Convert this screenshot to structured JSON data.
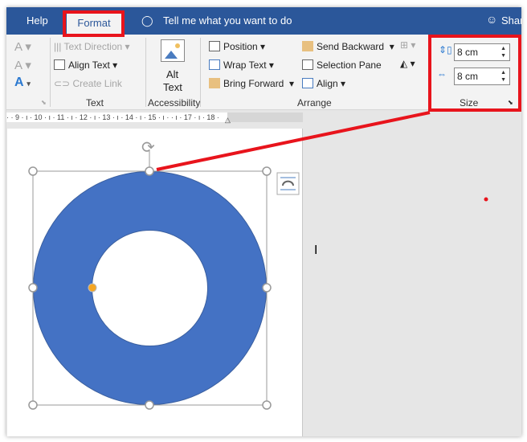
{
  "tabs": {
    "help": "Help",
    "format": "Format",
    "tell_me": "Tell me what you want to do",
    "share": "Share"
  },
  "ribbon": {
    "text_group": {
      "text_direction": "Text Direction",
      "align_text": "Align Text",
      "create_link": "Create Link",
      "label": "Text"
    },
    "accessibility_group": {
      "alt_text_line1": "Alt",
      "alt_text_line2": "Text",
      "label": "Accessibility"
    },
    "arrange_group": {
      "position": "Position",
      "wrap_text": "Wrap Text",
      "bring_forward": "Bring Forward",
      "send_backward": "Send Backward",
      "selection_pane": "Selection Pane",
      "align": "Align",
      "label": "Arrange"
    },
    "size_group": {
      "height": "8 cm",
      "width": "8 cm",
      "label": "Size"
    }
  },
  "ruler": {
    "ticks": "·  ·  9  ·  ı  · 10 ·  ı  · 11 ·  ı  · 12 ·  ı  · 13 ·  ı  · 14 ·  ı  · 15 ·  ı  ·  ·  ı  · 17 ·  ı  · 18 ·"
  },
  "shape": {
    "fill": "#4472c4",
    "type": "donut",
    "adjust_handle_color": "#f5a623"
  },
  "colors": {
    "title_bar": "#2b579a",
    "highlight": "#e8141c"
  }
}
